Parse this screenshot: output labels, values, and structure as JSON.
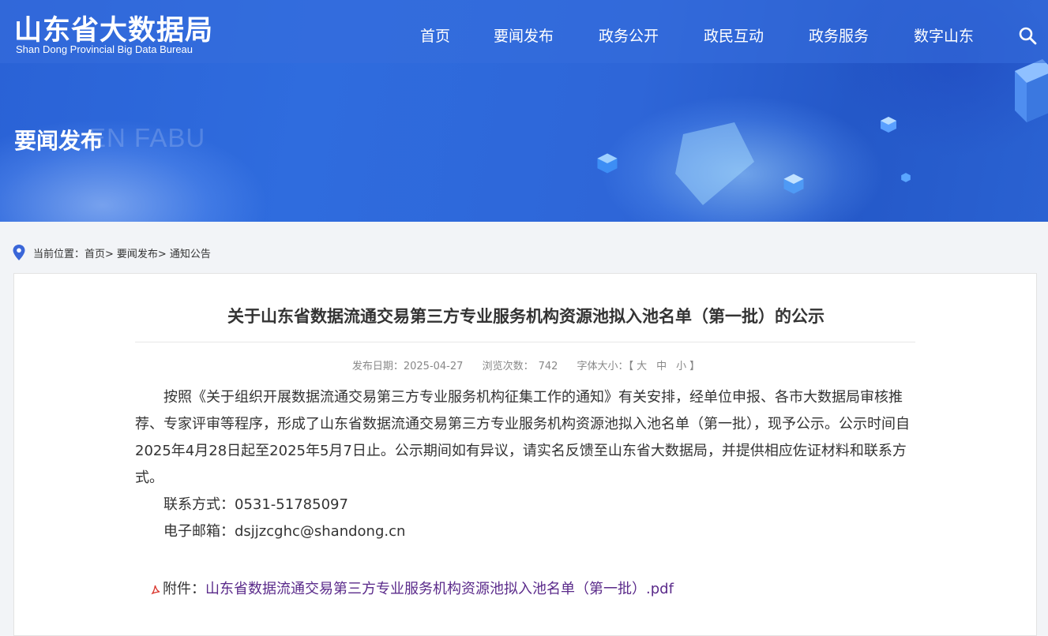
{
  "header": {
    "logo_cn": "山东省大数据局",
    "logo_en": "Shan Dong Provincial Big Data Bureau",
    "nav": [
      "首页",
      "要闻发布",
      "政务公开",
      "政民互动",
      "政务服务",
      "数字山东"
    ]
  },
  "banner": {
    "title": "要闻发布",
    "subtitle": "EN FABU"
  },
  "breadcrumb": {
    "prefix": "当前位置：",
    "items": [
      "首页>",
      "要闻发布>",
      "通知公告"
    ]
  },
  "article": {
    "title": "关于山东省数据流通交易第三方专业服务机构资源池拟入池名单（第一批）的公示",
    "meta": {
      "date_label": "发布日期：2025-04-27",
      "views_label": "浏览次数：",
      "views": "742",
      "font_size_label": "字体大小：",
      "bracket_open": "【",
      "size_large": "大",
      "size_medium": "中",
      "size_small": "小",
      "bracket_close": "】"
    },
    "paragraph": "按照《关于组织开展数据流通交易第三方专业服务机构征集工作的通知》有关安排，经单位申报、各市大数据局审核推荐、专家评审等程序，形成了山东省数据流通交易第三方专业服务机构资源池拟入池名单（第一批），现予公示。公示时间自2025年4月28日起至2025年5月7日止。公示期间如有异议，请实名反馈至山东省大数据局，并提供相应佐证材料和联系方式。",
    "contact_phone": "联系方式：0531-51785097",
    "contact_email": "电子邮箱：dsjjzcghc@shandong.cn",
    "attachment_label": "附件：",
    "attachment_name": "山东省数据流通交易第三方专业服务机构资源池拟入池名单（第一批）.pdf"
  },
  "colors": {
    "banner_blue": "#2f6cde",
    "link_purple": "#5a2a8a",
    "pin_blue": "#3a66d8"
  }
}
